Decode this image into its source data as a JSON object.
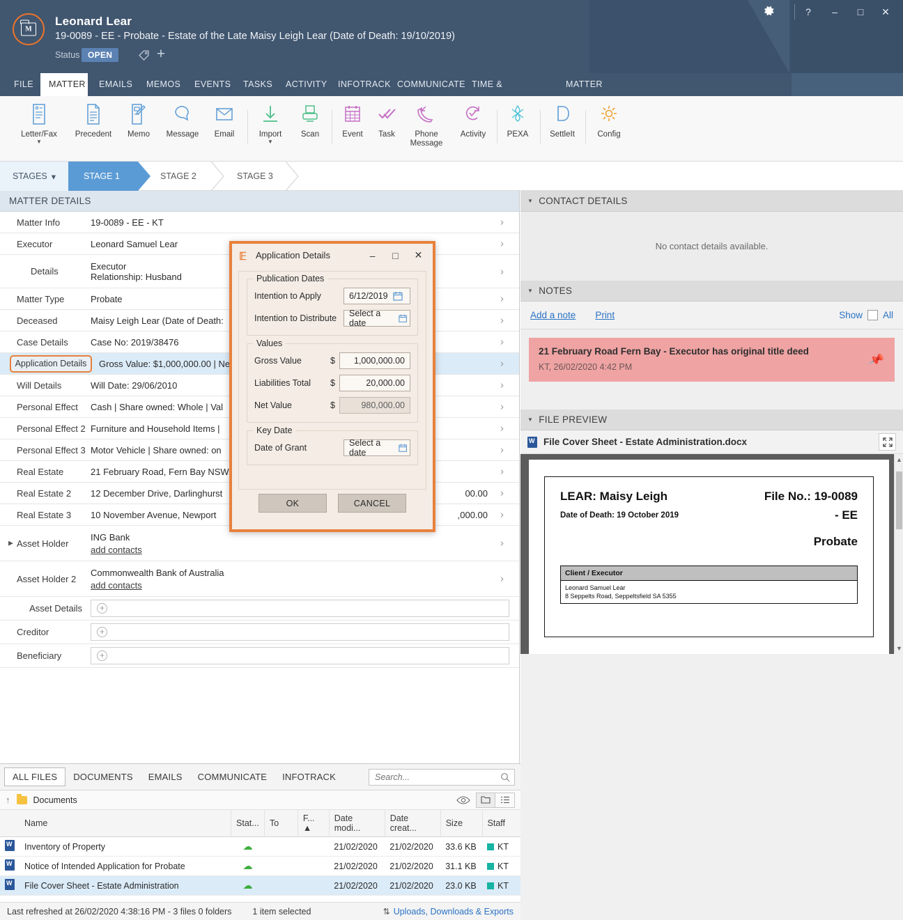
{
  "titlebar": {
    "client_name": "Leonard Lear",
    "matter_desc": "19-0089 - EE - Probate - Estate of the Late Maisy Leigh Lear (Date of Death: 19/10/2019)",
    "status_label": "Status",
    "status_value": "OPEN",
    "window_buttons": {
      "help": "?",
      "minimize": "–",
      "maximize": "□",
      "close": "✕"
    }
  },
  "nav_tabs": [
    {
      "label": "FILE",
      "active": false
    },
    {
      "label": "MATTER",
      "active": true
    },
    {
      "label": "EMAILS",
      "active": false
    },
    {
      "label": "MEMOS",
      "active": false
    },
    {
      "label": "EVENTS",
      "active": false
    },
    {
      "label": "TASKS",
      "active": false
    },
    {
      "label": "ACTIVITY",
      "active": false
    },
    {
      "label": "INFOTRACK",
      "active": false
    },
    {
      "label": "COMMUNICATE",
      "active": false
    },
    {
      "label": "TIME & EXPENSES",
      "active": false
    },
    {
      "label": "MATTER INSIGHTS",
      "active": false
    }
  ],
  "ribbon": [
    {
      "label": "Letter/Fax",
      "icon": "letter-fax-icon",
      "caret": true
    },
    {
      "label": "Precedent",
      "icon": "precedent-icon",
      "caret": false
    },
    {
      "label": "Memo",
      "icon": "memo-icon",
      "caret": false
    },
    {
      "label": "Message",
      "icon": "message-icon",
      "caret": false
    },
    {
      "label": "Email",
      "icon": "email-icon",
      "caret": false
    },
    {
      "label": "Import",
      "icon": "import-icon",
      "caret": true
    },
    {
      "label": "Scan",
      "icon": "scan-icon",
      "caret": false
    },
    {
      "label": "Event",
      "icon": "event-icon",
      "caret": false
    },
    {
      "label": "Task",
      "icon": "task-icon",
      "caret": false
    },
    {
      "label": "Phone Message",
      "icon": "phone-message-icon",
      "caret": false
    },
    {
      "label": "Activity",
      "icon": "activity-icon",
      "caret": false
    },
    {
      "label": "PEXA",
      "icon": "pexa-icon",
      "caret": false
    },
    {
      "label": "SettleIt",
      "icon": "settleit-icon",
      "caret": false
    },
    {
      "label": "Config",
      "icon": "config-gear-icon",
      "caret": false
    }
  ],
  "stages": {
    "label": "STAGES",
    "items": [
      {
        "label": "STAGE 1",
        "active": true
      },
      {
        "label": "STAGE 2",
        "active": false
      },
      {
        "label": "STAGE 3",
        "active": false
      }
    ]
  },
  "matter_details": {
    "header": "MATTER DETAILS",
    "rows": [
      {
        "label": "Matter Info",
        "value": "19-0089 - EE - KT"
      },
      {
        "label": "Executor",
        "value": "Leonard Samuel Lear"
      },
      {
        "label": "Details",
        "value": "Executor",
        "value2": "Relationship: Husband",
        "indent": true
      },
      {
        "label": "Matter Type",
        "value": "Probate"
      },
      {
        "label": "Deceased",
        "value": "Maisy Leigh Lear (Date of Death:"
      },
      {
        "label": "Case Details",
        "value": "Case No: 2019/38476"
      },
      {
        "label": "Application Details",
        "value": "Gross Value: $1,000,000.00 | Net",
        "selected": true
      },
      {
        "label": "Will Details",
        "value": "Will Date: 29/06/2010"
      },
      {
        "label": "Personal Effect",
        "value": "Cash | Share owned: Whole | Val"
      },
      {
        "label": "Personal Effect 2",
        "value": "Furniture and Household Items |"
      },
      {
        "label": "Personal Effect 3",
        "value": "Motor Vehicle | Share owned: on"
      },
      {
        "label": "Real Estate",
        "value": "21 February Road, Fern Bay NSW"
      },
      {
        "label": "Real Estate 2",
        "value": "12 December Drive, Darlinghurst",
        "value_right": "00.00"
      },
      {
        "label": "Real Estate 3",
        "value": "10 November Avenue, Newport",
        "value_right": ",000.00"
      },
      {
        "label": "Asset Holder",
        "value": "ING Bank",
        "link": "add contacts",
        "expander": true
      },
      {
        "label": "Asset Holder 2",
        "value": "Commonwealth Bank of Australia",
        "link": "add contacts"
      },
      {
        "label": "Asset Details",
        "field": true,
        "right_align": true
      },
      {
        "label": "Creditor",
        "field": true
      },
      {
        "label": "Beneficiary",
        "field": true
      }
    ]
  },
  "contact_details": {
    "header": "CONTACT DETAILS",
    "empty_message": "No contact details available."
  },
  "notes": {
    "header": "NOTES",
    "add_label": "Add a note",
    "print_label": "Print",
    "show_label": "Show",
    "all_label": "All",
    "items": [
      {
        "text": "21 February Road Fern Bay - Executor has original title deed",
        "meta": "KT, 26/02/2020 4:42 PM"
      }
    ]
  },
  "file_preview": {
    "header": "FILE PREVIEW",
    "filename": "File Cover Sheet - Estate Administration.docx",
    "document": {
      "name_line": "LEAR: Maisy Leigh",
      "date_of_death": "Date of Death: 19 October 2019",
      "file_no": "File No.: 19-0089",
      "file_no_suffix": "- EE",
      "matter_type": "Probate",
      "table_header": "Client / Executor",
      "table_line1": "Leonard Samuel Lear",
      "table_line2": "8 Seppelts Road, Seppeltsfield SA 5355"
    }
  },
  "files": {
    "tabs": [
      {
        "label": "ALL FILES",
        "active": true
      },
      {
        "label": "DOCUMENTS",
        "active": false
      },
      {
        "label": "EMAILS",
        "active": false
      },
      {
        "label": "COMMUNICATE",
        "active": false
      },
      {
        "label": "INFOTRACK",
        "active": false
      }
    ],
    "search_placeholder": "Search...",
    "breadcrumb": "Documents",
    "columns": [
      "Name",
      "Stat...",
      "To",
      "F... ▲",
      "Date modi...",
      "Date creat...",
      "Size",
      "Staff"
    ],
    "rows": [
      {
        "name": "Inventory of Property",
        "status": "cloud",
        "to": "",
        "from": "",
        "date_modified": "21/02/2020",
        "date_created": "21/02/2020",
        "size": "33.6 KB",
        "staff": "KT",
        "selected": false
      },
      {
        "name": "Notice of Intended Application for Probate",
        "status": "cloud",
        "to": "",
        "from": "",
        "date_modified": "21/02/2020",
        "date_created": "21/02/2020",
        "size": "31.1 KB",
        "staff": "KT",
        "selected": false
      },
      {
        "name": "File Cover Sheet - Estate Administration",
        "status": "cloud",
        "to": "",
        "from": "",
        "date_modified": "21/02/2020",
        "date_created": "21/02/2020",
        "size": "23.0 KB",
        "staff": "KT",
        "selected": true
      }
    ],
    "status_refreshed": "Last refreshed at 26/02/2020 4:38:16 PM  -  3 files  0 folders",
    "status_selected": "1 item selected",
    "uploads_link": "Uploads, Downloads & Exports"
  },
  "dialog": {
    "title": "Application Details",
    "minimize": "–",
    "maximize": "□",
    "close": "✕",
    "groups": {
      "publication": {
        "title": "Publication Dates",
        "intention_apply_label": "Intention to Apply",
        "intention_apply_value": "6/12/2019",
        "intention_distribute_label": "Intention to Distribute",
        "intention_distribute_value": "Select a date"
      },
      "values": {
        "title": "Values",
        "gross_label": "Gross Value",
        "gross_value": "1,000,000.00",
        "liabilities_label": "Liabilities Total",
        "liabilities_value": "20,000.00",
        "net_label": "Net Value",
        "net_value": "980,000.00",
        "currency": "$"
      },
      "key_date": {
        "title": "Key Date",
        "grant_label": "Date of Grant",
        "grant_value": "Select a date"
      }
    },
    "ok_label": "OK",
    "cancel_label": "CANCEL"
  },
  "colors": {
    "header_blue": "#41566f",
    "accent_orange": "#e8813c",
    "stage_active": "#5b9bd5",
    "selection_blue": "#dbebf8",
    "note_red": "#efa3a3",
    "link_blue": "#2a72c4"
  }
}
